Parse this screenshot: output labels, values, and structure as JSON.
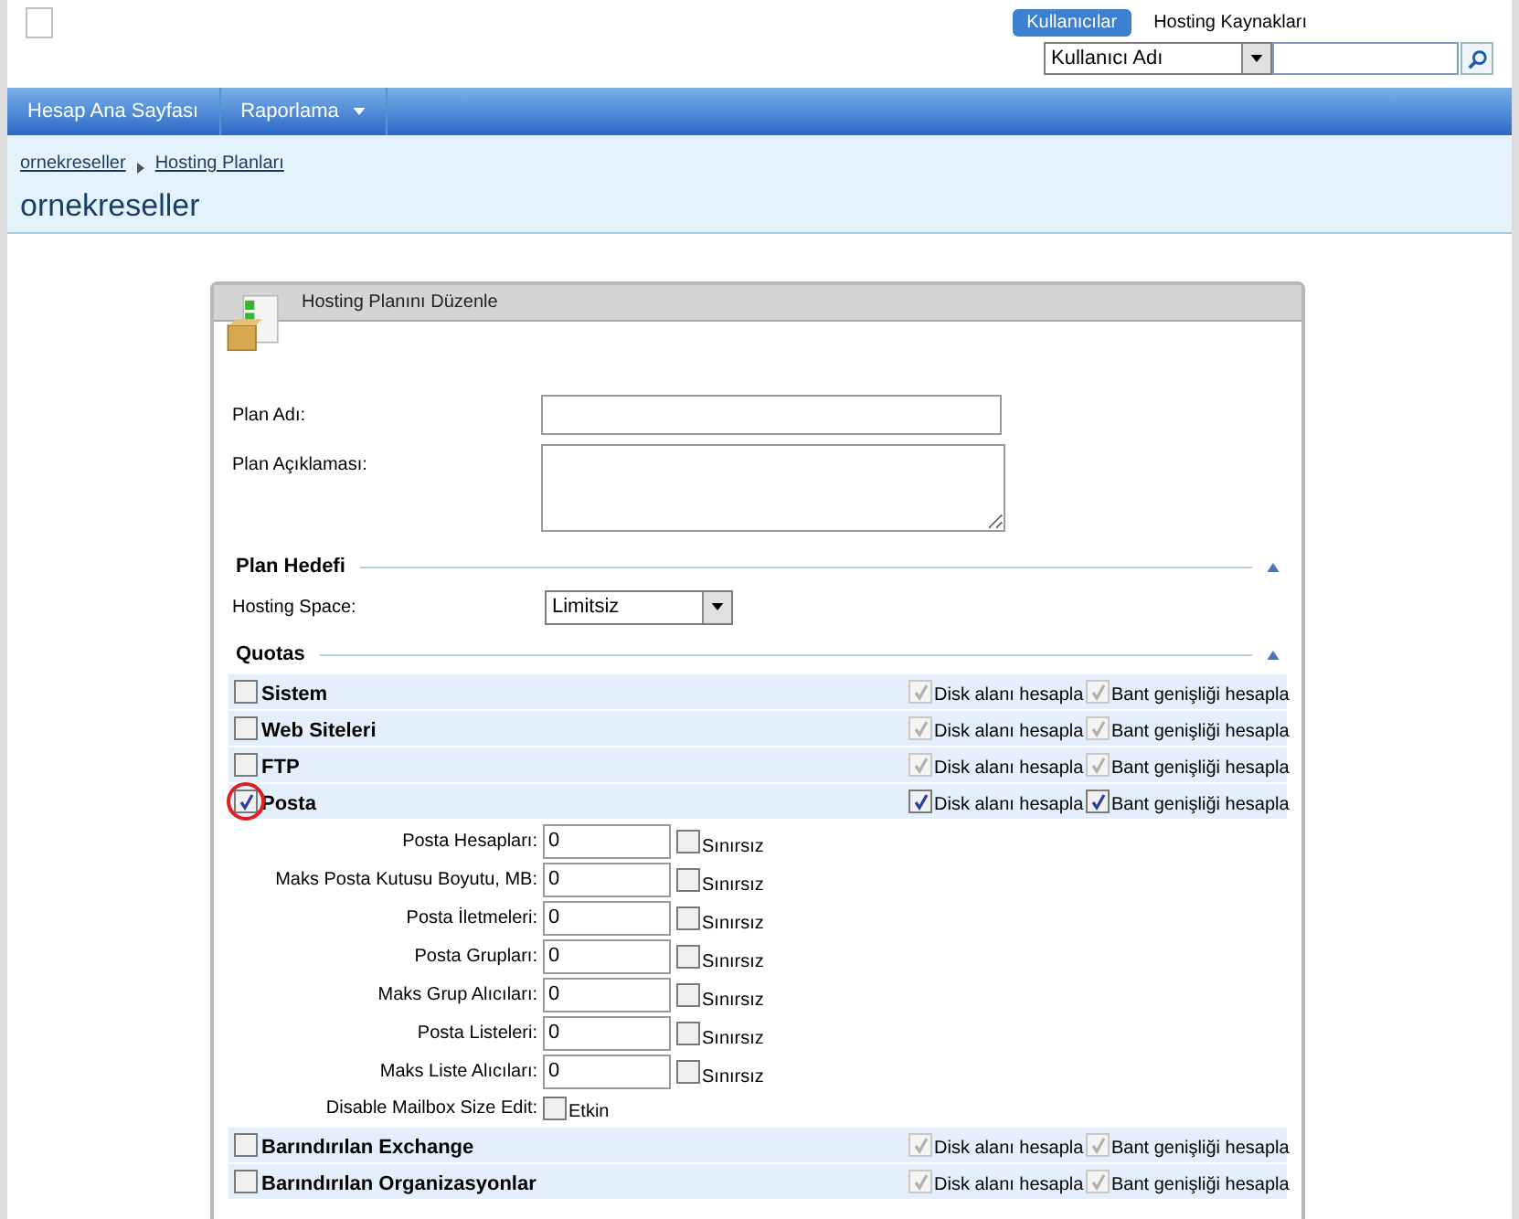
{
  "header": {
    "tabs": [
      {
        "label": "Kullanıcılar",
        "selected": true
      },
      {
        "label": "Hosting Kaynakları",
        "selected": false
      }
    ],
    "search": {
      "select": "Kullanıcı Adı"
    }
  },
  "nav": [
    {
      "label": "Hesap Ana Sayfası",
      "dropdown": false
    },
    {
      "label": "Raporlama",
      "dropdown": true
    }
  ],
  "breadcrumb": [
    "ornekreseller",
    "Hosting Planları"
  ],
  "page_title": "ornekreseller",
  "panel": {
    "title": "Hosting Planını Düzenle",
    "fields": [
      {
        "label": "Plan Adı:",
        "kind": "text"
      },
      {
        "label": "Plan Açıklaması:",
        "kind": "textarea"
      }
    ],
    "plan_target": {
      "heading": "Plan Hedefi",
      "label": "Hosting Space:",
      "value": "Limitsiz"
    },
    "quotas_heading": "Quotas",
    "quotas": [
      {
        "name": "Sistem",
        "checked": false,
        "circled": false,
        "disk": {
          "label": "Disk alanı hesapla",
          "checked": true,
          "disabled": true
        },
        "bandwidth": {
          "label": "Bant genişliği hesapla",
          "checked": true,
          "disabled": true
        }
      },
      {
        "name": "Web Siteleri",
        "checked": false,
        "circled": false,
        "disk": {
          "label": "Disk alanı hesapla",
          "checked": true,
          "disabled": true
        },
        "bandwidth": {
          "label": "Bant genişliği hesapla",
          "checked": true,
          "disabled": true
        }
      },
      {
        "name": "FTP",
        "checked": false,
        "circled": false,
        "disk": {
          "label": "Disk alanı hesapla",
          "checked": true,
          "disabled": true
        },
        "bandwidth": {
          "label": "Bant genişliği hesapla",
          "checked": true,
          "disabled": true
        }
      },
      {
        "name": "Posta",
        "checked": true,
        "circled": true,
        "disk": {
          "label": "Disk alanı hesapla",
          "checked": true,
          "disabled": false
        },
        "bandwidth": {
          "label": "Bant genişliği hesapla",
          "checked": true,
          "disabled": false
        },
        "items": [
          {
            "kind": "number",
            "label": "Posta Hesapları:",
            "value": "0",
            "check_label": "Sınırsız",
            "checked": false
          },
          {
            "kind": "number",
            "label": "Maks Posta Kutusu Boyutu, MB:",
            "value": "0",
            "check_label": "Sınırsız",
            "checked": false
          },
          {
            "kind": "number",
            "label": "Posta İletmeleri:",
            "value": "0",
            "check_label": "Sınırsız",
            "checked": false
          },
          {
            "kind": "number",
            "label": "Posta Grupları:",
            "value": "0",
            "check_label": "Sınırsız",
            "checked": false
          },
          {
            "kind": "number",
            "label": "Maks Grup Alıcıları:",
            "value": "0",
            "check_label": "Sınırsız",
            "checked": false
          },
          {
            "kind": "number",
            "label": "Posta Listeleri:",
            "value": "0",
            "check_label": "Sınırsız",
            "checked": false
          },
          {
            "kind": "number",
            "label": "Maks Liste Alıcıları:",
            "value": "0",
            "check_label": "Sınırsız",
            "checked": false
          },
          {
            "kind": "toggle",
            "label": "Disable Mailbox Size Edit:",
            "check_label": "Etkin",
            "checked": false
          }
        ]
      },
      {
        "name": "Barındırılan Exchange",
        "checked": false,
        "circled": false,
        "disk": {
          "label": "Disk alanı hesapla",
          "checked": true,
          "disabled": true
        },
        "bandwidth": {
          "label": "Bant genişliği hesapla",
          "checked": true,
          "disabled": true
        }
      },
      {
        "name": "Barındırılan Organizasyonlar",
        "checked": false,
        "circled": false,
        "disk": {
          "label": "Disk alanı hesapla",
          "checked": true,
          "disabled": true
        },
        "bandwidth": {
          "label": "Bant genişliği hesapla",
          "checked": true,
          "disabled": true
        }
      }
    ]
  }
}
